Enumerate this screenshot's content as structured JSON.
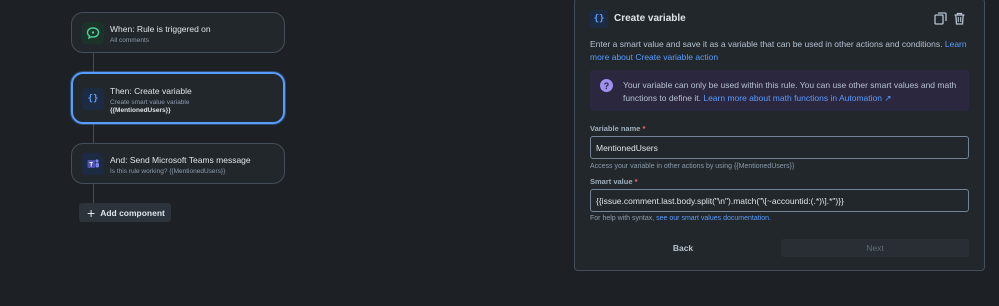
{
  "flow": {
    "trigger": {
      "title": "When: Rule is triggered on",
      "subtitle": "All comments",
      "icon": "comment-icon",
      "color": "#4bce97"
    },
    "action1": {
      "title": "Then: Create variable",
      "subtitle": "Create smart value variable",
      "subtitle2": "{{MentionedUsers}}",
      "icon": "curly-braces-icon",
      "color": "#579dff"
    },
    "action2": {
      "title": "And: Send Microsoft Teams message",
      "subtitle": "Is this rule working? {{MentionedUsers}}",
      "icon": "teams-icon",
      "color": "#4f52b2"
    },
    "add_component": "Add component"
  },
  "panel": {
    "title": "Create variable",
    "icon": "curly-braces-icon",
    "description": "Enter a smart value and save it as a variable that can be used in other actions and conditions.",
    "description_link": "Learn more about Create variable action",
    "info": {
      "text": "Your variable can only be used within this rule. You can use other smart values and math functions to define it.",
      "link": "Learn more about math functions in Automation ↗"
    },
    "variable_name": {
      "label": "Variable name",
      "required_mark": "*",
      "value": "MentionedUsers",
      "help": "Access your variable in other actions by using {{MentionedUsers}}"
    },
    "smart_value": {
      "label": "Smart value",
      "required_mark": "*",
      "value": "{{issue.comment.last.body.split(\"\\n\").match(\"\\[~accountid:(.*)\\].*\")}}",
      "help": "For help with syntax,",
      "help_link": "see our smart values documentation."
    },
    "back_label": "Back",
    "next_label": "Next"
  },
  "colors": {
    "background": "#1d2125",
    "accent": "#579dff",
    "info_background": "#2b273f"
  }
}
